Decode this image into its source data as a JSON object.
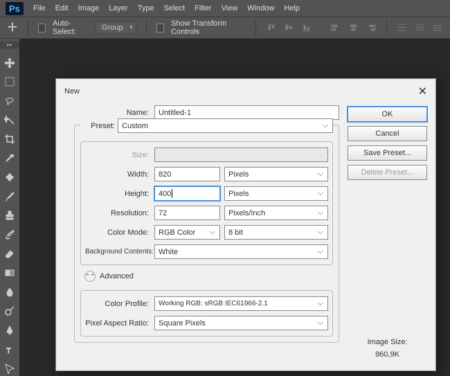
{
  "menubar": {
    "items": [
      "File",
      "Edit",
      "Image",
      "Layer",
      "Type",
      "Select",
      "Filter",
      "View",
      "Window",
      "Help"
    ],
    "logo": "Ps"
  },
  "toolbar": {
    "auto_select": "Auto-Select:",
    "group": "Group",
    "show_transform": "Show Transform Controls"
  },
  "dialog": {
    "title": "New",
    "name_label": "Name:",
    "name_value": "Untitled-1",
    "preset_label": "Preset:",
    "preset_value": "Custom",
    "size_label": "Size:",
    "width_label": "Width:",
    "width_value": "820",
    "width_unit": "Pixels",
    "height_label": "Height:",
    "height_value": "400",
    "height_unit": "Pixels",
    "resolution_label": "Resolution:",
    "resolution_value": "72",
    "resolution_unit": "Pixels/Inch",
    "colormode_label": "Color Mode:",
    "colormode_value": "RGB Color",
    "colordepth_value": "8 bit",
    "bg_label": "Background Contents:",
    "bg_value": "White",
    "advanced": "Advanced",
    "profile_label": "Color Profile:",
    "profile_value": "Working RGB:  sRGB IEC61966-2.1",
    "aspect_label": "Pixel Aspect Ratio:",
    "aspect_value": "Square Pixels",
    "ok": "OK",
    "cancel": "Cancel",
    "save_preset": "Save Preset...",
    "delete_preset": "Delete Preset...",
    "image_size_label": "Image Size:",
    "image_size_value": "960,9K"
  }
}
